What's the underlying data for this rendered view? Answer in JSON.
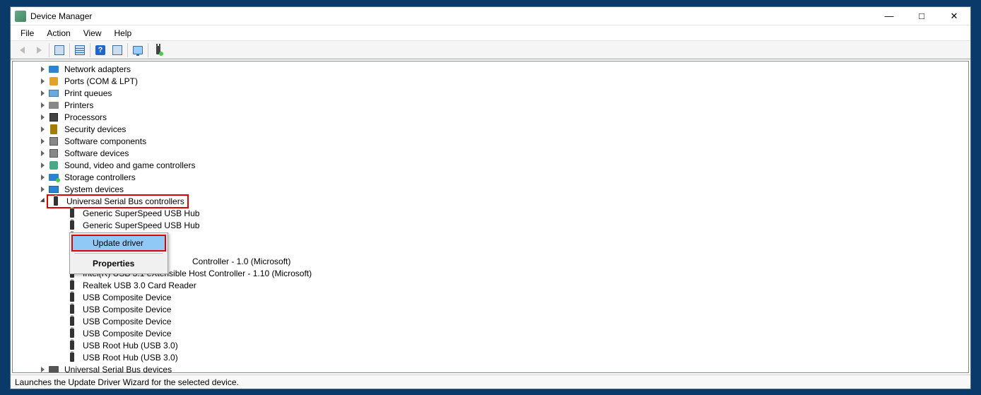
{
  "window": {
    "title": "Device Manager"
  },
  "menubar": [
    "File",
    "Action",
    "View",
    "Help"
  ],
  "statusbar": "Launches the Update Driver Wizard for the selected device.",
  "context_menu": {
    "items": [
      {
        "label": "Update driver",
        "selected": true
      },
      {
        "label": "Properties",
        "bold": true
      }
    ]
  },
  "tree": {
    "categories": [
      {
        "label": "Network adapters",
        "icon": "ico-net"
      },
      {
        "label": "Ports (COM & LPT)",
        "icon": "ico-port"
      },
      {
        "label": "Print queues",
        "icon": "ico-printq"
      },
      {
        "label": "Printers",
        "icon": "ico-printer"
      },
      {
        "label": "Processors",
        "icon": "ico-cpu"
      },
      {
        "label": "Security devices",
        "icon": "ico-sec"
      },
      {
        "label": "Software components",
        "icon": "ico-soft"
      },
      {
        "label": "Software devices",
        "icon": "ico-soft"
      },
      {
        "label": "Sound, video and game controllers",
        "icon": "ico-sound"
      },
      {
        "label": "Storage controllers",
        "icon": "ico-storage"
      },
      {
        "label": "System devices",
        "icon": "ico-sys"
      }
    ],
    "usb_category": {
      "label": "Universal Serial Bus controllers",
      "children": [
        "Generic SuperSpeed USB Hub",
        "Generic SuperSpeed USB Hub"
      ],
      "children_after": [
        "Intel(R) USB 3.1 eXtensible Host Controller - 1.10 (Microsoft)",
        "Realtek USB 3.0 Card Reader",
        "USB Composite Device",
        "USB Composite Device",
        "USB Composite Device",
        "USB Composite Device",
        "USB Root Hub (USB 3.0)",
        "USB Root Hub (USB 3.0)"
      ],
      "partial_visible_behind_menu": "Controller - 1.0 (Microsoft)",
      "hidden_rows_count": 3
    },
    "last_category": {
      "label": "Universal Serial Bus devices"
    }
  }
}
